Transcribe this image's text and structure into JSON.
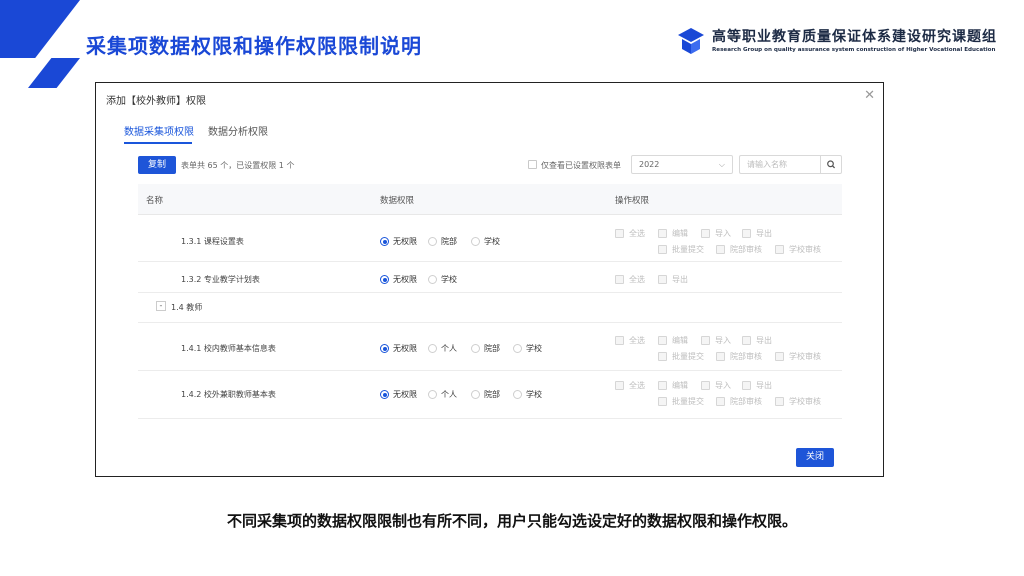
{
  "slide": {
    "title": "采集项数据权限和操作权限限制说明",
    "brand_cn": "高等职业教育质量保证体系建设研究课题组",
    "brand_en": "Research Group on quality assurance system construction of Higher Vocational Education",
    "footer": "不同采集项的数据权限限制也有所不同，用户只能勾选设定好的数据权限和操作权限。",
    "accent_color": "#1a48d6"
  },
  "dialog": {
    "title": "添加【校外教师】权限",
    "close_icon": "close-icon",
    "tabs": [
      {
        "label": "数据采集项权限",
        "active": true
      },
      {
        "label": "数据分析权限",
        "active": false
      }
    ],
    "toolbar": {
      "copy_label": "复制",
      "summary": "表单共 65 个，已设置权限 1 个",
      "only_set_label": "仅查看已设置权限表单",
      "year_value": "2022",
      "search_placeholder": "请输入名称",
      "search_icon": "search-icon"
    },
    "columns": {
      "name": "名称",
      "data_perm": "数据权限",
      "op_perm": "操作权限"
    },
    "rows": [
      {
        "name": "1.3.1 课程设置表",
        "radios": [
          "无权限",
          "院部",
          "学校"
        ],
        "selected": "无权限",
        "ops": [
          [
            "全选",
            "编辑",
            "导入",
            "导出"
          ],
          [
            "批量提交",
            "院部审核",
            "学校审核"
          ]
        ]
      },
      {
        "name": "1.3.2 专业教学计划表",
        "radios": [
          "无权限",
          "学校"
        ],
        "selected": "无权限",
        "ops": [
          [
            "全选",
            "导出"
          ]
        ]
      },
      {
        "group": "1.4 教师",
        "collapse_label": "-"
      },
      {
        "name": "1.4.1 校内教师基本信息表",
        "radios": [
          "无权限",
          "个人",
          "院部",
          "学校"
        ],
        "selected": "无权限",
        "ops": [
          [
            "全选",
            "编辑",
            "导入",
            "导出"
          ],
          [
            "批量提交",
            "院部审核",
            "学校审核"
          ]
        ]
      },
      {
        "name": "1.4.2 校外兼职教师基本表",
        "radios": [
          "无权限",
          "个人",
          "院部",
          "学校"
        ],
        "selected": "无权限",
        "ops": [
          [
            "全选",
            "编辑",
            "导入",
            "导出"
          ],
          [
            "批量提交",
            "院部审核",
            "学校审核"
          ]
        ]
      }
    ],
    "close_label": "关闭"
  }
}
